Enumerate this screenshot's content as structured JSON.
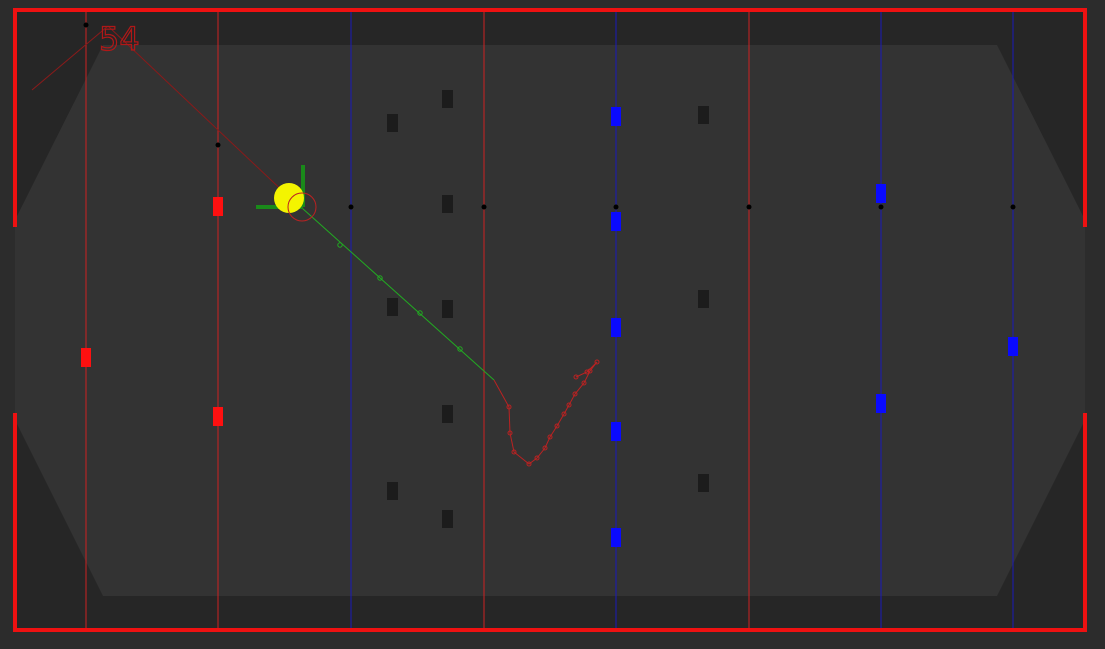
{
  "scoreboard": {
    "count": "54"
  },
  "colors": {
    "background": "#2c2c2c",
    "arena_floor": "#262626",
    "playfield": "#333333",
    "boundary": "#ee1111",
    "red_rod": "#cc2222",
    "blue_rod": "#1a1abb",
    "red_player": "#ff1010",
    "blue_player": "#0a0aff",
    "obstacle": "#1c1c1c",
    "ball": "#f4f400",
    "aim_vector": "#1a8a1a",
    "planned_path": "#22aa22",
    "predicted_path": "#bb2222"
  },
  "rods": [
    {
      "team": "red"
    },
    {
      "team": "red"
    },
    {
      "team": "blue"
    },
    {
      "team": "red"
    },
    {
      "team": "blue"
    },
    {
      "team": "red"
    },
    {
      "team": "blue"
    },
    {
      "team": "blue"
    }
  ]
}
